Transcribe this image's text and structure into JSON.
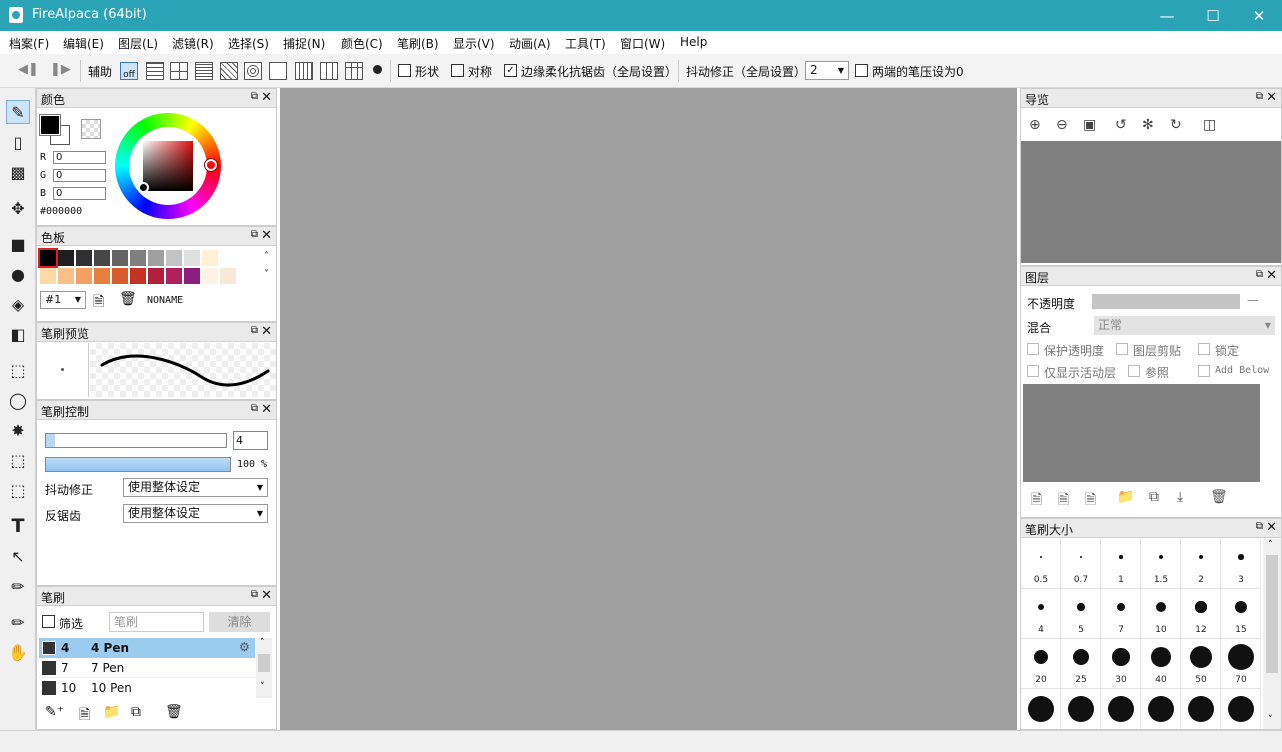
{
  "window": {
    "title": "FireAlpaca (64bit)"
  },
  "menu": [
    "档案(F)",
    "编辑(E)",
    "图层(L)",
    "滤镜(R)",
    "选择(S)",
    "捕捉(N)",
    "颜色(C)",
    "笔刷(B)",
    "显示(V)",
    "动画(A)",
    "工具(T)",
    "窗口(W)",
    "Help"
  ],
  "toolbar": {
    "assist_label": "辅助",
    "off_label": "off",
    "shape_label": "形状",
    "symmetry_label": "对称",
    "aa_label": "边缘柔化抗锯齿（全局设置）",
    "stab_label": "抖动修正（全局设置）",
    "stab_value": "2",
    "pressure_label": "两端的笔压设为0",
    "aa_checked": true
  },
  "color_panel": {
    "title": "颜色",
    "r_label": "R",
    "g_label": "G",
    "b_label": "B",
    "r": "0",
    "g": "0",
    "b": "0",
    "hex": "#000000"
  },
  "palette_panel": {
    "title": "色板",
    "set": "#1",
    "name": "NONAME",
    "row1": [
      "#000000",
      "#1e1e1e",
      "#303030",
      "#474747",
      "#646464",
      "#7f7f7f",
      "#a0a0a0",
      "#c3c3c3",
      "#e0e0e0",
      "#fff0d6"
    ],
    "row2": [
      "#fdd9a8",
      "#fbc08a",
      "#f2a162",
      "#e5803d",
      "#d95d2c",
      "#c43225",
      "#b21f3b",
      "#b01f5e",
      "#8c1f7d",
      "#fdf2e6",
      "#f8e8d8"
    ]
  },
  "brush_preview": {
    "title": "笔刷预览"
  },
  "brush_control": {
    "title": "笔刷控制",
    "size": "4",
    "opacity": "100",
    "opacity_unit": "%",
    "size_fraction": 0.05,
    "opacity_fraction": 1.0,
    "stab_label": "抖动修正",
    "stab_value": "使用整体设定",
    "aa_label": "反锯齿",
    "aa_value": "使用整体设定"
  },
  "brush_panel": {
    "title": "笔刷",
    "filter_label": "筛选",
    "search_placeholder": "笔刷",
    "clear_label": "清除",
    "items": [
      {
        "size": "4",
        "name": "4 Pen"
      },
      {
        "size": "7",
        "name": "7 Pen"
      },
      {
        "size": "10",
        "name": "10 Pen"
      }
    ]
  },
  "navigator": {
    "title": "导览"
  },
  "layers": {
    "title": "图层",
    "opacity_label": "不透明度",
    "opacity_value": "—",
    "blend_label": "混合",
    "blend_value": "正常",
    "protect_alpha": "保护透明度",
    "clipping": "图层剪贴",
    "lock": "锁定",
    "show_active": "仅显示活动层",
    "reference": "参照",
    "add_below": "Add Below"
  },
  "brush_size": {
    "title": "笔刷大小",
    "sizes": [
      "0.5",
      "0.7",
      "1",
      "1.5",
      "2",
      "3",
      "4",
      "5",
      "7",
      "10",
      "12",
      "15",
      "20",
      "25",
      "30",
      "40",
      "50",
      "70",
      "",
      "",
      "",
      "",
      "",
      ""
    ]
  }
}
